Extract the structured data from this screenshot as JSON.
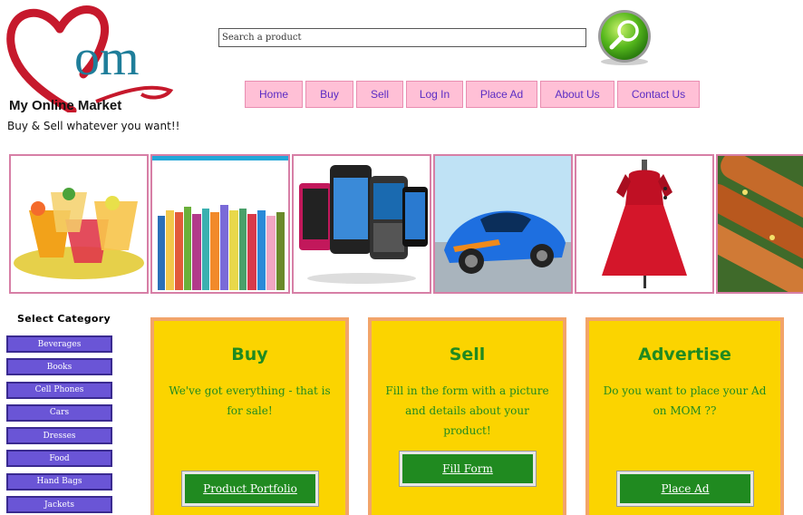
{
  "brand": {
    "logo_text": "om",
    "name": "My Online Market",
    "tagline": "Buy & Sell whatever you want!!"
  },
  "search": {
    "placeholder": "Search a product"
  },
  "nav": [
    "Home",
    "Buy",
    "Sell",
    "Log In",
    "Place Ad",
    "About Us",
    "Contact Us"
  ],
  "banner": [
    "beverages-image",
    "books-image",
    "cell-phones-image",
    "car-image",
    "dress-image",
    "food-image"
  ],
  "sidebar": {
    "title": "Select Category",
    "categories": [
      "Beverages",
      "Books",
      "Cell Phones",
      "Cars",
      "Dresses",
      "Food",
      "Hand Bags",
      "Jackets"
    ]
  },
  "cards": [
    {
      "title": "Buy",
      "text": "We've got everything - that is for sale!",
      "button": "Product Portfolio"
    },
    {
      "title": "Sell",
      "text": "Fill in the form with a picture and details about your product!",
      "button": "Fill Form"
    },
    {
      "title": "Advertise",
      "text": "Do you want to place your Ad on MOM ??",
      "button": "Place Ad"
    }
  ],
  "colors": {
    "nav_bg": "#ffc0d6",
    "nav_text": "#5a2cc4",
    "card_bg": "#fbd400",
    "card_text": "#208a20",
    "category_bg": "#6a55d6"
  }
}
